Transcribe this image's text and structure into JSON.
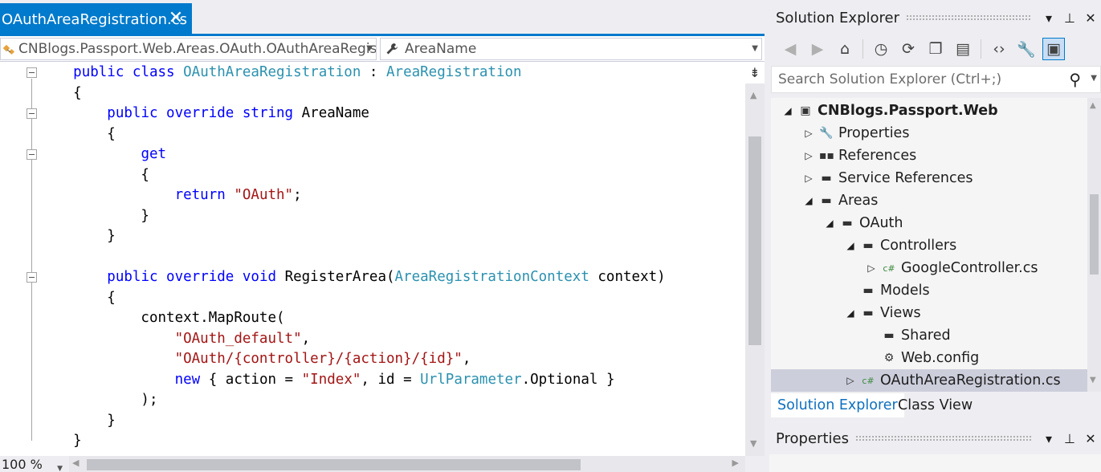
{
  "editor": {
    "tab_title": "OAuthAreaRegistration.cs",
    "tab_close": "✕",
    "class_combo": "CNBlogs.Passport.Web.Areas.OAuth.OAuthAreaRegist",
    "member_combo": "AreaName",
    "zoom": "100 %",
    "code": [
      [
        [
          "    ",
          ""
        ],
        [
          "public class ",
          "kw"
        ],
        [
          "OAuthAreaRegistration",
          "ty"
        ],
        [
          " : ",
          ""
        ],
        [
          "AreaRegistration",
          "ty"
        ]
      ],
      [
        [
          "    {",
          ""
        ]
      ],
      [
        [
          "        ",
          ""
        ],
        [
          "public override string ",
          "kw"
        ],
        [
          "AreaName",
          ""
        ]
      ],
      [
        [
          "        {",
          ""
        ]
      ],
      [
        [
          "            ",
          ""
        ],
        [
          "get",
          "kw"
        ]
      ],
      [
        [
          "            {",
          ""
        ]
      ],
      [
        [
          "                ",
          ""
        ],
        [
          "return ",
          "kw"
        ],
        [
          "\"OAuth\"",
          "st"
        ],
        [
          ";",
          ""
        ]
      ],
      [
        [
          "            }",
          ""
        ]
      ],
      [
        [
          "        }",
          ""
        ]
      ],
      [
        [
          "",
          ""
        ]
      ],
      [
        [
          "        ",
          ""
        ],
        [
          "public override void ",
          "kw"
        ],
        [
          "RegisterArea(",
          ""
        ],
        [
          "AreaRegistrationContext",
          "ty"
        ],
        [
          " context)",
          ""
        ]
      ],
      [
        [
          "        {",
          ""
        ]
      ],
      [
        [
          "            context.MapRoute(",
          ""
        ]
      ],
      [
        [
          "                ",
          ""
        ],
        [
          "\"OAuth_default\"",
          "st"
        ],
        [
          ",",
          ""
        ]
      ],
      [
        [
          "                ",
          ""
        ],
        [
          "\"OAuth/{controller}/{action}/{id}\"",
          "st"
        ],
        [
          ",",
          ""
        ]
      ],
      [
        [
          "                ",
          ""
        ],
        [
          "new ",
          "kw"
        ],
        [
          "{ action = ",
          ""
        ],
        [
          "\"Index\"",
          "st"
        ],
        [
          ", id = ",
          ""
        ],
        [
          "UrlParameter",
          "ty"
        ],
        [
          ".Optional }",
          ""
        ]
      ],
      [
        [
          "            );",
          ""
        ]
      ],
      [
        [
          "        }",
          ""
        ]
      ],
      [
        [
          "    }",
          ""
        ]
      ]
    ]
  },
  "solution_explorer": {
    "title": "Solution Explorer",
    "search_placeholder": "Search Solution Explorer (Ctrl+;)",
    "tree": [
      {
        "label": "CNBlogs.Passport.Web",
        "indent": 0,
        "expander": "◢",
        "icon": "csproj-icon",
        "glyph": "▣",
        "bold": true
      },
      {
        "label": "Properties",
        "indent": 1,
        "expander": "▷",
        "icon": "wrench-icon",
        "glyph": "🔧"
      },
      {
        "label": "References",
        "indent": 1,
        "expander": "▷",
        "icon": "references-icon",
        "glyph": "▪▪"
      },
      {
        "label": "Service References",
        "indent": 1,
        "expander": "▷",
        "icon": "folder-icon",
        "glyph": "▬"
      },
      {
        "label": "Areas",
        "indent": 1,
        "expander": "◢",
        "icon": "folder-open-icon",
        "glyph": "▬"
      },
      {
        "label": "OAuth",
        "indent": 2,
        "expander": "◢",
        "icon": "folder-open-icon",
        "glyph": "▬"
      },
      {
        "label": "Controllers",
        "indent": 3,
        "expander": "◢",
        "icon": "folder-open-icon",
        "glyph": "▬"
      },
      {
        "label": "GoogleController.cs",
        "indent": 4,
        "expander": "▷",
        "icon": "csharp-file-icon",
        "glyph": "c#"
      },
      {
        "label": "Models",
        "indent": 3,
        "expander": "",
        "icon": "folder-icon",
        "glyph": "▬"
      },
      {
        "label": "Views",
        "indent": 3,
        "expander": "◢",
        "icon": "folder-open-icon",
        "glyph": "▬"
      },
      {
        "label": "Shared",
        "indent": 4,
        "expander": "",
        "icon": "folder-icon",
        "glyph": "▬"
      },
      {
        "label": "Web.config",
        "indent": 4,
        "expander": "",
        "icon": "config-file-icon",
        "glyph": "⚙"
      },
      {
        "label": "OAuthAreaRegistration.cs",
        "indent": 3,
        "expander": "▷",
        "icon": "csharp-file-icon",
        "glyph": "c#",
        "selected": true
      }
    ],
    "tabs": [
      "Solution Explorer",
      "Class View"
    ]
  },
  "properties": {
    "title": "Properties"
  },
  "colors": {
    "accent": "#007acc",
    "keyword": "#0000ff",
    "type": "#2b91af",
    "string": "#a31515"
  }
}
